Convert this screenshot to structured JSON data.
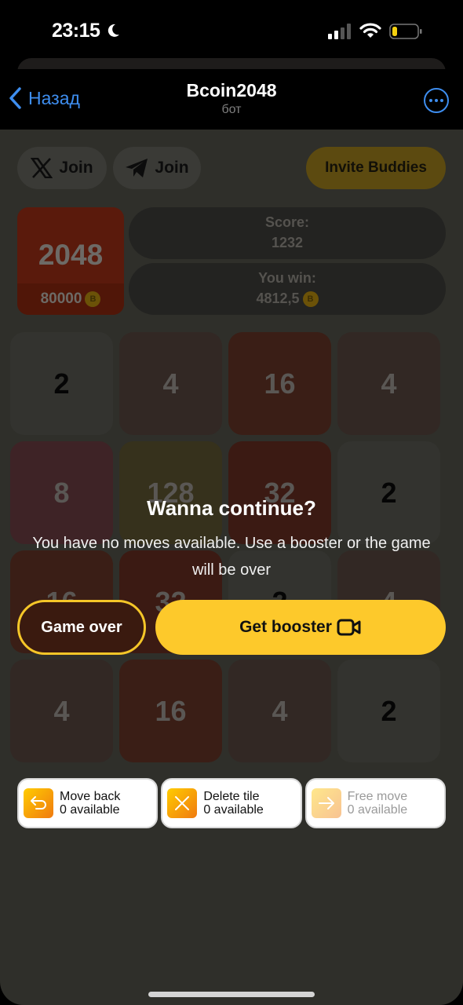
{
  "status_bar": {
    "time": "23:15",
    "icons": [
      "moon-icon",
      "cellular-signal-icon",
      "wifi-icon",
      "battery-low-icon"
    ]
  },
  "nav": {
    "back_label": "Назад",
    "title": "Bcoin2048",
    "subtitle": "бот",
    "more_icon": "more-circle-icon"
  },
  "top_buttons": {
    "x_join": "Join",
    "telegram_join": "Join",
    "invite": "Invite Buddies"
  },
  "best_tile": {
    "value": "2048",
    "reward": "80000",
    "coin_symbol": "B"
  },
  "stats": {
    "score_label": "Score:",
    "score_value": "1232",
    "win_label": "You win:",
    "win_value": "4812,5",
    "coin_symbol": "B"
  },
  "board": {
    "rows": [
      [
        "2",
        "4",
        "16",
        "4"
      ],
      [
        "8",
        "128",
        "32",
        "2"
      ],
      [
        "16",
        "32",
        "2",
        "4"
      ],
      [
        "4",
        "16",
        "4",
        "2"
      ]
    ],
    "colors": {
      "2": "#33332f",
      "4": "#322824",
      "8": "#3e2326",
      "16": "#3a1e16",
      "32": "#3b1a13",
      "128": "#36311c"
    }
  },
  "dialog": {
    "title": "Wanna continue?",
    "message": "You have no moves available. Use a booster or the game will be over",
    "game_over_label": "Game over",
    "get_booster_label": "Get booster",
    "accent_color": "#fdc92b"
  },
  "boosters": [
    {
      "name": "Move back",
      "available": "0 available",
      "icon": "undo-arrow-icon",
      "enabled": true
    },
    {
      "name": "Delete tile",
      "available": "0 available",
      "icon": "close-x-icon",
      "enabled": true
    },
    {
      "name": "Free move",
      "available": "0 available",
      "icon": "arrow-right-icon",
      "enabled": false
    }
  ]
}
